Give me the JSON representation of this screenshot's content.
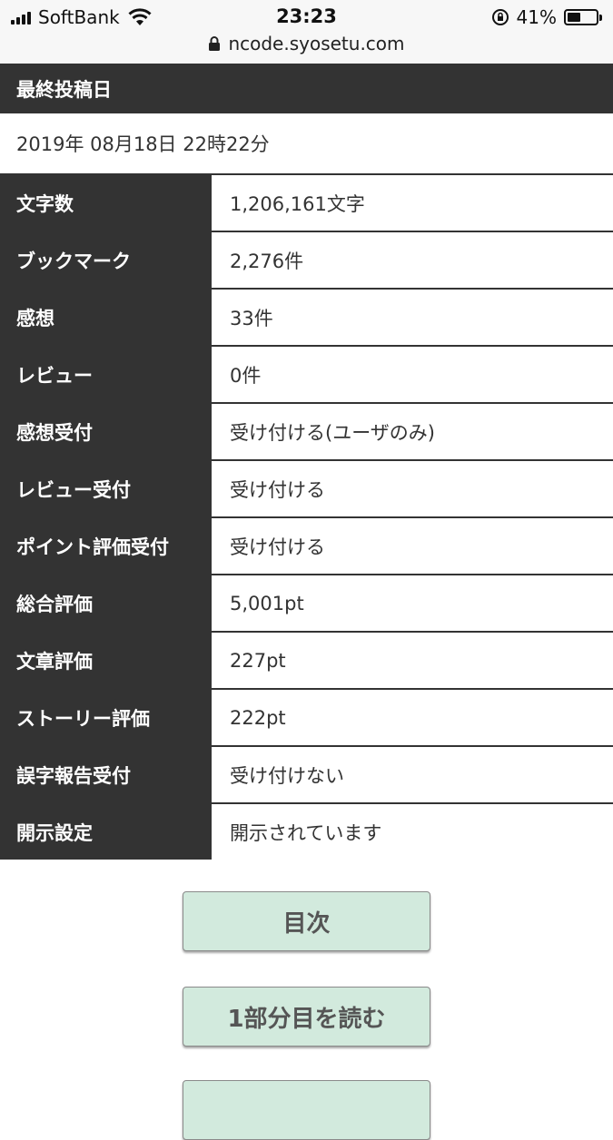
{
  "status_bar": {
    "carrier": "SoftBank",
    "time": "23:23",
    "battery_percent": "41%",
    "battery_level": 0.41,
    "url": "ncode.syosetu.com"
  },
  "last_post": {
    "label": "最終投稿日",
    "value": "2019年 08月18日 22時22分"
  },
  "info_rows": [
    {
      "label": "文字数",
      "value": "1,206,161文字"
    },
    {
      "label": "ブックマーク",
      "value": "2,276件"
    },
    {
      "label": "感想",
      "value": "33件"
    },
    {
      "label": "レビュー",
      "value": "0件"
    },
    {
      "label": "感想受付",
      "value": "受け付ける(ユーザのみ)"
    },
    {
      "label": "レビュー受付",
      "value": "受け付ける"
    },
    {
      "label": "ポイント評価受付",
      "value": "受け付ける"
    },
    {
      "label": "総合評価",
      "value": "5,001pt"
    },
    {
      "label": "文章評価",
      "value": "227pt"
    },
    {
      "label": "ストーリー評価",
      "value": "222pt"
    },
    {
      "label": "誤字報告受付",
      "value": "受け付けない"
    },
    {
      "label": "開示設定",
      "value": "開示されています"
    }
  ],
  "buttons": {
    "toc_label": "目次",
    "read_first_label": "1部分目を読む"
  },
  "colors": {
    "header_bg": "#333333",
    "button_bg": "#d2eadd"
  }
}
